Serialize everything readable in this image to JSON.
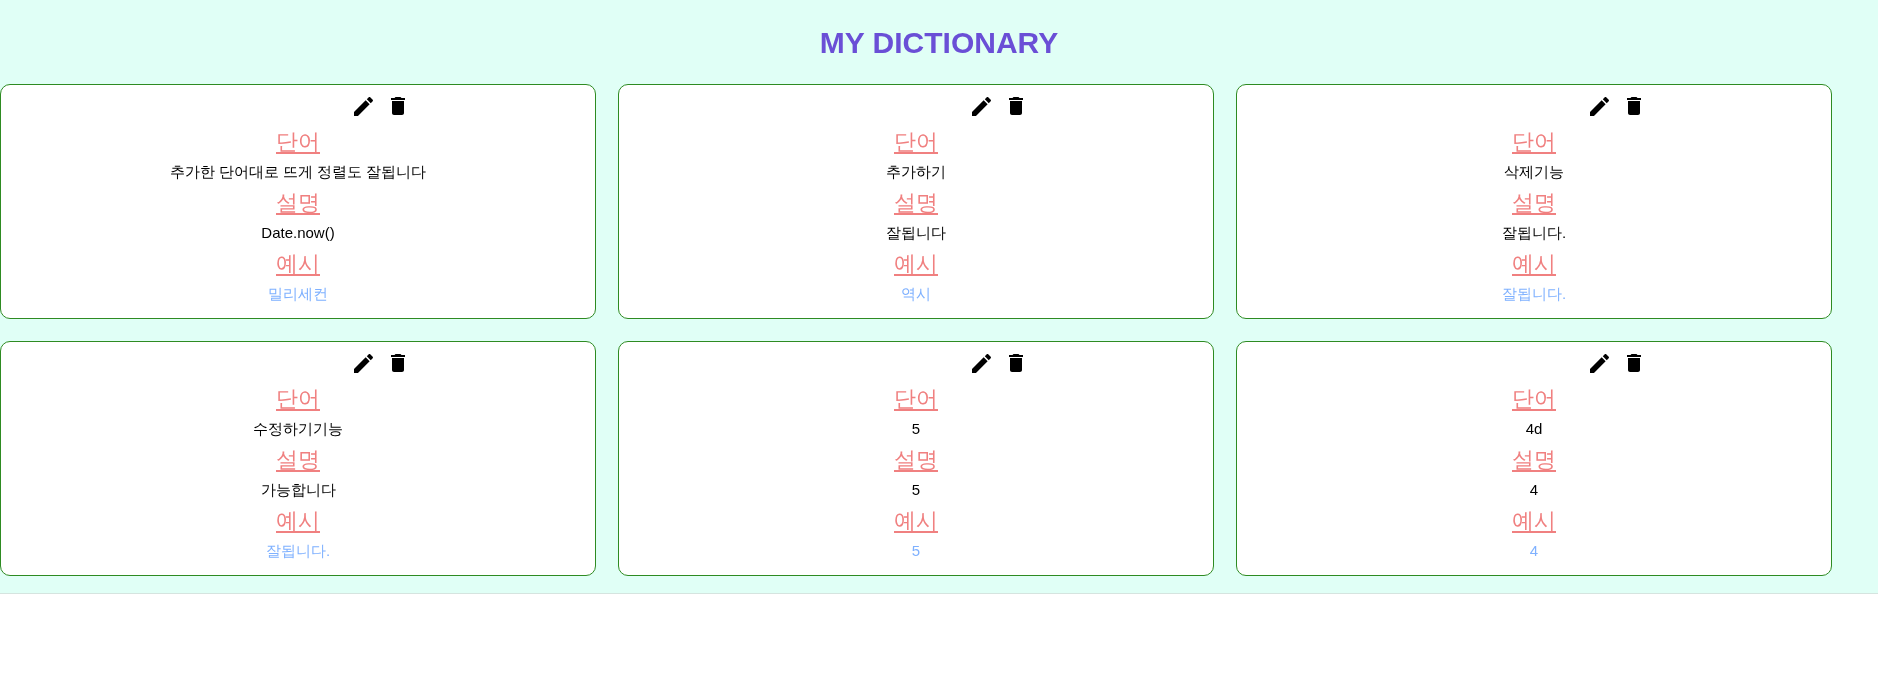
{
  "title": "MY DICTIONARY",
  "cards": [
    {
      "fields": [
        {
          "kind": "term",
          "label": "단어",
          "value": "추가한 단어대로 뜨게 정렬도 잘됩니다"
        },
        {
          "kind": "meaning",
          "label": "설명",
          "value": "Date.now()"
        },
        {
          "kind": "example",
          "label": "예시",
          "value": "밀리세컨"
        }
      ]
    },
    {
      "fields": [
        {
          "kind": "term",
          "label": "단어",
          "value": "추가하기"
        },
        {
          "kind": "meaning",
          "label": "설명",
          "value": "잘됩니다"
        },
        {
          "kind": "example",
          "label": "예시",
          "value": "역시"
        }
      ]
    },
    {
      "fields": [
        {
          "kind": "term",
          "label": "단어",
          "value": "삭제기능"
        },
        {
          "kind": "meaning",
          "label": "설명",
          "value": "잘됩니다."
        },
        {
          "kind": "example",
          "label": "예시",
          "value": "잘됩니다."
        }
      ]
    },
    {
      "fields": [
        {
          "kind": "term",
          "label": "단어",
          "value": "수정하기기능"
        },
        {
          "kind": "meaning",
          "label": "설명",
          "value": "가능합니다"
        },
        {
          "kind": "example",
          "label": "예시",
          "value": "잘됩니다."
        }
      ]
    },
    {
      "fields": [
        {
          "kind": "term",
          "label": "단어",
          "value": "5"
        },
        {
          "kind": "meaning",
          "label": "설명",
          "value": "5"
        },
        {
          "kind": "example",
          "label": "예시",
          "value": "5"
        }
      ]
    },
    {
      "fields": [
        {
          "kind": "term",
          "label": "단어",
          "value": "4d"
        },
        {
          "kind": "meaning",
          "label": "설명",
          "value": "4"
        },
        {
          "kind": "example",
          "label": "예시",
          "value": "4"
        }
      ]
    }
  ]
}
